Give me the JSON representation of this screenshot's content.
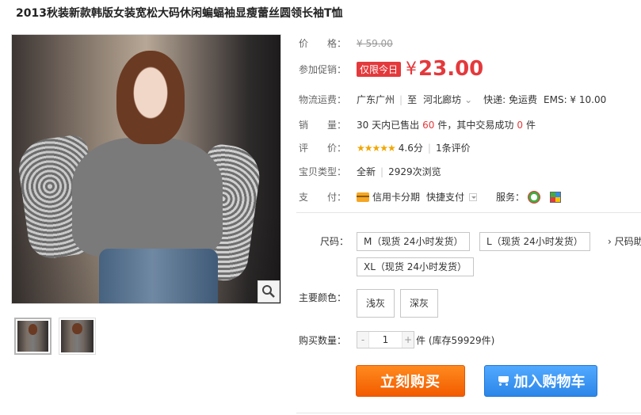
{
  "product": {
    "title": "2013秋装新款韩版女装宽松大码休闲蝙蝠袖显瘦蕾丝圆领长袖T恤"
  },
  "price": {
    "label": "价　　格：",
    "original": "¥ 59.00"
  },
  "promo": {
    "label": "参加促销：",
    "tag": "仅限今日",
    "currency": "¥",
    "price": "23.00"
  },
  "shipping": {
    "label": "物流运费：",
    "from": "广东广州",
    "to_prefix": "至",
    "to": "河北廊坊",
    "express": "快递: 免运费",
    "ems": "EMS: ¥ 10.00"
  },
  "sales": {
    "label": "销　　量：",
    "prefix": "30 天内已售出",
    "count": "60",
    "mid": "件，其中交易成功",
    "success": "0",
    "suffix": "件"
  },
  "rating": {
    "label": "评　　价：",
    "stars": "★★★★★",
    "score": "4.6分",
    "reviews": "1条评价"
  },
  "item_type": {
    "label": "宝贝类型：",
    "condition": "全新",
    "views": "2929次浏览"
  },
  "payment": {
    "label": "支　　付：",
    "credit": "信用卡分期",
    "quick": "快捷支付",
    "service_label": "服务："
  },
  "size": {
    "label": "尺码：",
    "options": [
      "M（现货 24小时发货）",
      "L（现货 24小时发货）",
      "XL（现货 24小时发货）"
    ],
    "chart_link": "› 尺码助"
  },
  "color": {
    "label": "主要颜色：",
    "options": [
      "浅灰",
      "深灰"
    ]
  },
  "quantity": {
    "label": "购买数量：",
    "minus": "-",
    "value": "1",
    "plus": "+",
    "stock": "件 (库存59929件)"
  },
  "actions": {
    "buy": "立刻购买",
    "cart": "加入购物车"
  },
  "colors": {
    "accent": "#e4393c",
    "buy": "#f25b00",
    "cart": "#2c86e8"
  }
}
